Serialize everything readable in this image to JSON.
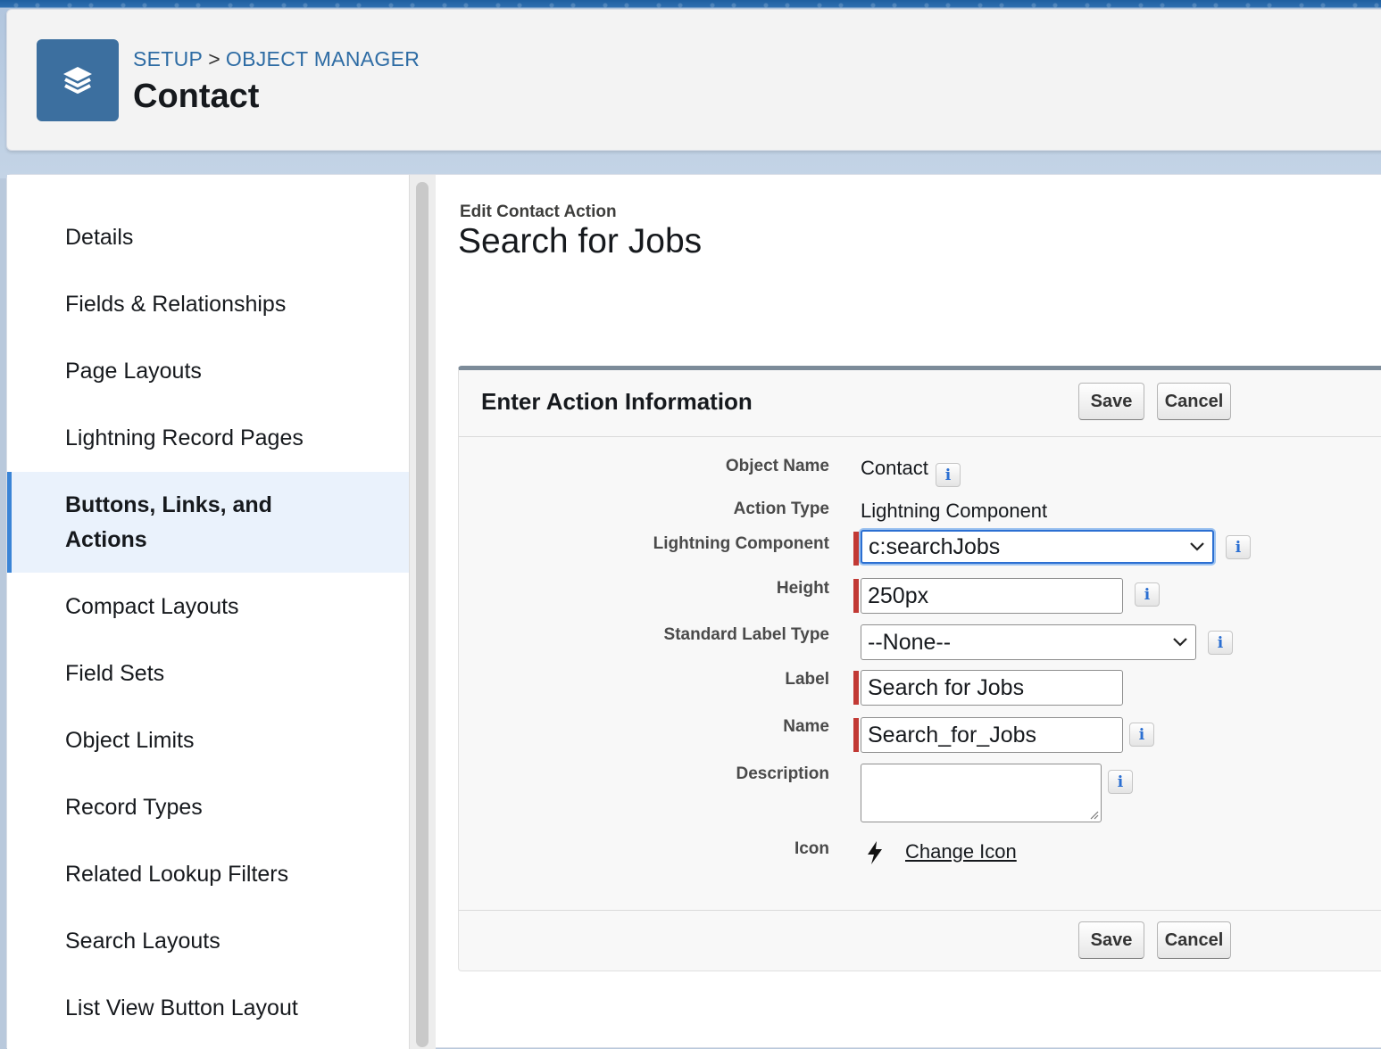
{
  "header": {
    "breadcrumb": [
      "SETUP",
      "OBJECT MANAGER"
    ],
    "separator": ">",
    "title": "Contact",
    "icon": "layers-icon"
  },
  "sidebar": {
    "items": [
      {
        "label": "Details"
      },
      {
        "label": "Fields & Relationships"
      },
      {
        "label": "Page Layouts"
      },
      {
        "label": "Lightning Record Pages"
      },
      {
        "label": "Buttons, Links, and Actions",
        "line1": "Buttons, Links, and",
        "line2": "Actions",
        "active": true
      },
      {
        "label": "Compact Layouts"
      },
      {
        "label": "Field Sets"
      },
      {
        "label": "Object Limits"
      },
      {
        "label": "Record Types"
      },
      {
        "label": "Related Lookup Filters"
      },
      {
        "label": "Search Layouts"
      },
      {
        "label": "List View Button Layout"
      }
    ]
  },
  "content": {
    "subtitle": "Edit Contact Action",
    "title": "Search for Jobs",
    "block": {
      "title": "Enter Action Information",
      "save_label": "Save",
      "cancel_label": "Cancel",
      "fields": {
        "object_name": {
          "label": "Object Name",
          "value": "Contact"
        },
        "action_type": {
          "label": "Action Type",
          "value": "Lightning Component"
        },
        "lightning_component": {
          "label": "Lightning Component",
          "value": "c:searchJobs"
        },
        "height": {
          "label": "Height",
          "value": "250px"
        },
        "standard_label_type": {
          "label": "Standard Label Type",
          "value": "--None--"
        },
        "label": {
          "label": "Label",
          "value": "Search for Jobs"
        },
        "name": {
          "label": "Name",
          "value": "Search_for_Jobs"
        },
        "description": {
          "label": "Description",
          "value": ""
        },
        "icon": {
          "label": "Icon",
          "link": "Change Icon",
          "icon": "lightning-bolt-icon"
        }
      },
      "info_glyph": "i"
    }
  },
  "colors": {
    "accent": "#3a84d6",
    "required": "#c23934",
    "header_icon_bg": "#3c6f9f",
    "breadcrumb": "#2e6ca4"
  }
}
